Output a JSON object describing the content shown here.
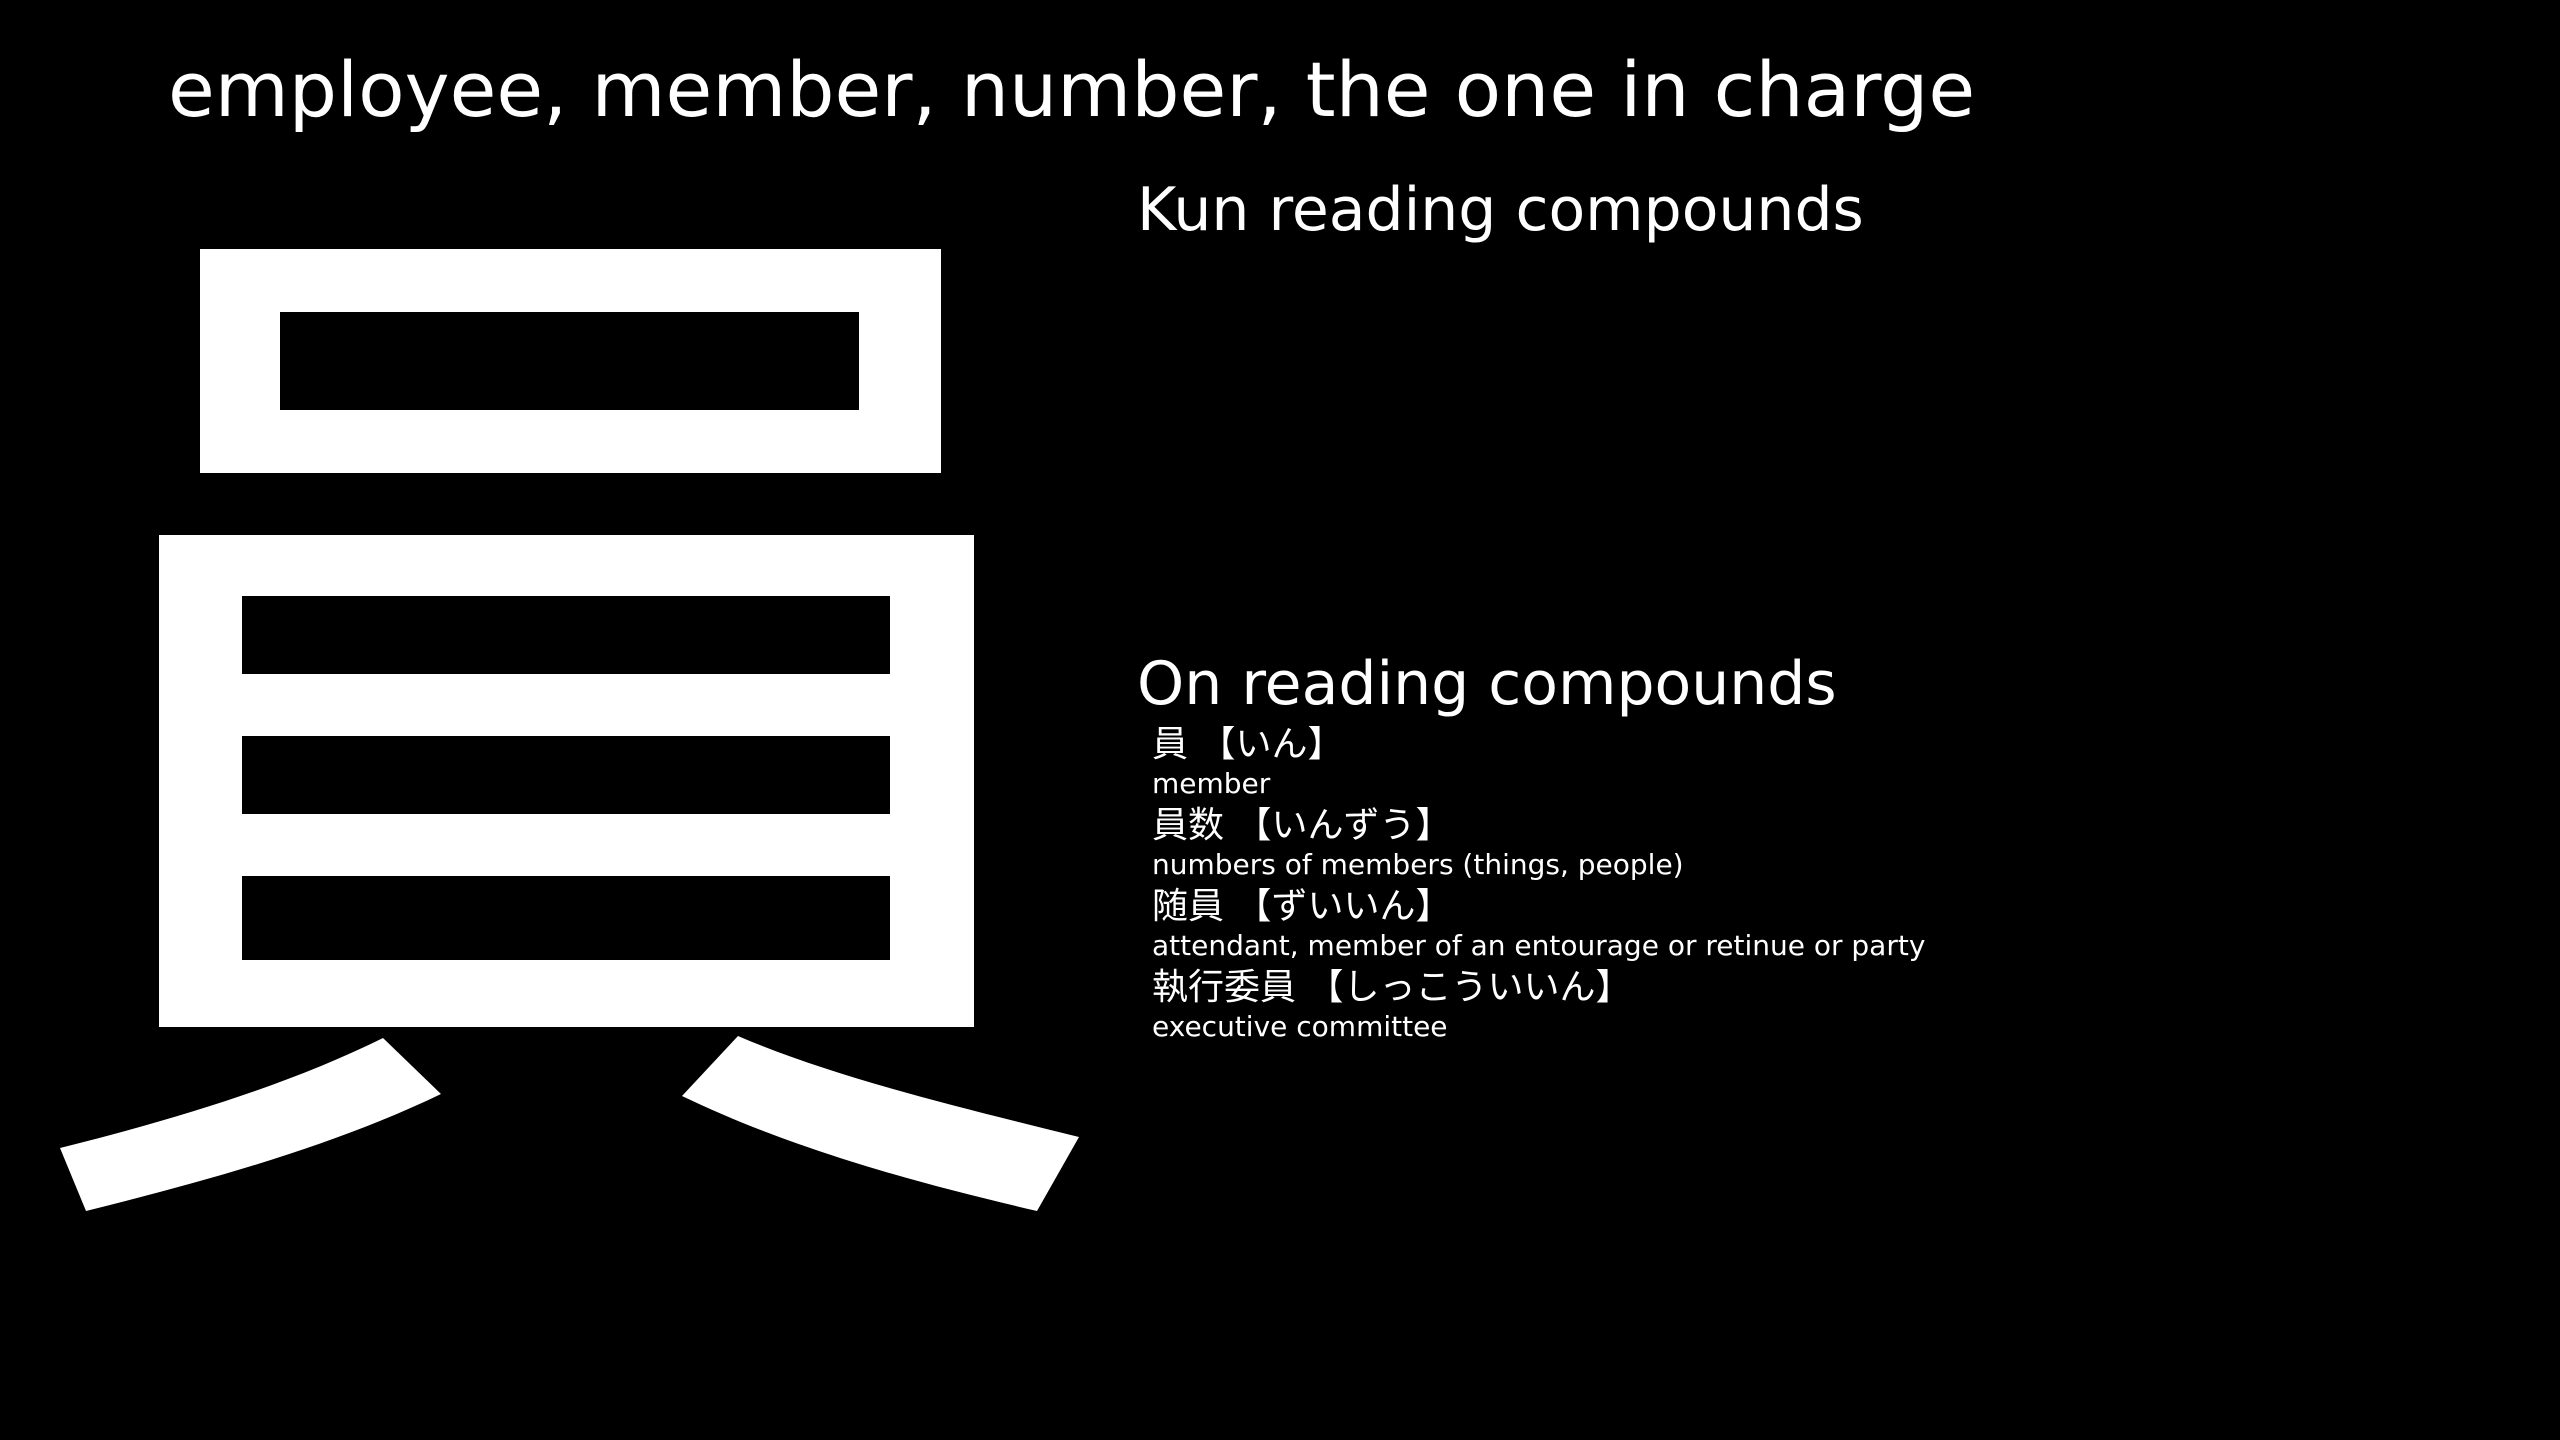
{
  "meaning": "employee, member, number, the one in charge",
  "kanji": "員",
  "kun_heading": "Kun reading compounds",
  "kun_compounds": [],
  "on_heading": "On reading compounds",
  "on_compounds": [
    {
      "term": "員 【いん】",
      "meaning": "member"
    },
    {
      "term": "員数 【いんずう】",
      "meaning": "numbers of members (things, people)"
    },
    {
      "term": "随員 【ずいいん】",
      "meaning": "attendant, member of an entourage or retinue or party"
    },
    {
      "term": "執行委員 【しっこういいん】",
      "meaning": "executive committee"
    }
  ],
  "colors": {
    "background": "#000000",
    "foreground": "#ffffff"
  }
}
